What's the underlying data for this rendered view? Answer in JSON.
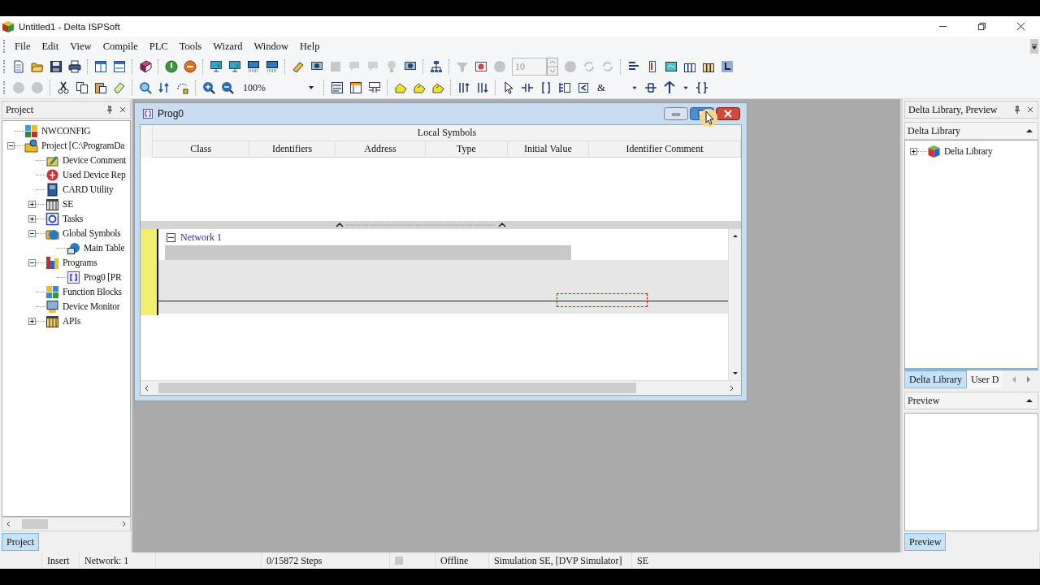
{
  "app": {
    "title": "Untitled1 - Delta ISPSoft"
  },
  "menu": [
    "File",
    "Edit",
    "View",
    "Compile",
    "PLC",
    "Tools",
    "Wizard",
    "Window",
    "Help"
  ],
  "toolbar": {
    "step_field": "10",
    "zoom": "100%",
    "symbol": "&"
  },
  "project_panel": {
    "title": "Project",
    "tree": [
      {
        "label": "NWCONFIG",
        "kind": "config"
      },
      {
        "label": "Project [C:\\ProgramDa",
        "kind": "project",
        "expanded": true,
        "children": [
          {
            "label": "Device Comment",
            "kind": "comment"
          },
          {
            "label": "Used Device Rep",
            "kind": "report"
          },
          {
            "label": "CARD Utility",
            "kind": "card"
          },
          {
            "label": "SE",
            "kind": "module",
            "expanded": false
          },
          {
            "label": "Tasks",
            "kind": "tasks",
            "expanded": false
          },
          {
            "label": "Global Symbols",
            "kind": "symbols",
            "expanded": true,
            "children": [
              {
                "label": "Main Table",
                "kind": "table"
              }
            ]
          },
          {
            "label": "Programs",
            "kind": "programs",
            "expanded": true,
            "children": [
              {
                "label": "Prog0 [PR",
                "kind": "program"
              }
            ]
          },
          {
            "label": "Function Blocks",
            "kind": "blocks"
          },
          {
            "label": "Device Monitor",
            "kind": "monitor"
          },
          {
            "label": "APIs",
            "kind": "apis",
            "expanded": false
          }
        ]
      }
    ],
    "tabs": [
      {
        "label": "Project",
        "selected": true
      }
    ]
  },
  "editor": {
    "title": "Prog0",
    "symbols": {
      "group": "Local Symbols",
      "columns": [
        "Class",
        "Identifiers",
        "Address",
        "Type",
        "Initial Value",
        "Identifier Comment"
      ]
    },
    "networks": [
      {
        "label": "Network 1",
        "expanded": true
      }
    ]
  },
  "library_panel": {
    "title": "Delta Library, Preview",
    "library": {
      "title": "Delta Library",
      "tree": [
        {
          "label": "Delta Library",
          "expanded": false
        }
      ],
      "tabs": [
        {
          "label": "Delta Library",
          "selected": true
        },
        {
          "label": "User D",
          "selected": false
        }
      ]
    },
    "preview": {
      "title": "Preview",
      "tabs": [
        {
          "label": "Preview",
          "selected": true
        }
      ]
    }
  },
  "status_bar": {
    "mode": "Insert",
    "network": "Network: 1",
    "steps": "0/15872 Steps",
    "connection": "Offline",
    "target": "Simulation SE, [DVP Simulator]",
    "model": "SE"
  }
}
